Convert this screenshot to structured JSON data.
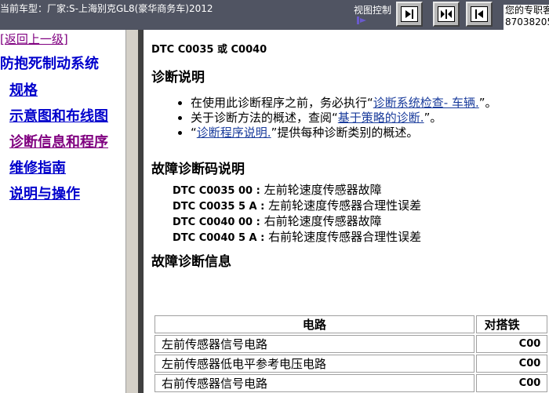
{
  "topbar": {
    "vehicle_label": "当前车型：厂家:S-上海别克GL8(豪华商务车)2012",
    "view_control_label": "视图控制",
    "contact_line1": "您的专职客",
    "contact_line2": "87038205"
  },
  "sidebar": {
    "back_link": "[返回上一级]",
    "system_title": "防抱死制动系统",
    "items": [
      {
        "label": "规格"
      },
      {
        "label": "示意图和布线图"
      },
      {
        "label": "诊断信息和程序"
      },
      {
        "label": "维修指南"
      },
      {
        "label": "说明与操作"
      }
    ]
  },
  "content": {
    "dtc_heading": "DTC C0035 或 C0040",
    "diag_desc_title": "诊断说明",
    "bullets": [
      {
        "pre": "在使用此诊断程序之前，务必执行“",
        "link": "诊断系统检查- 车辆.",
        "post": "”。"
      },
      {
        "pre": "关于诊断方法的概述，查阅“",
        "link": "基于策略的诊断.",
        "post": "”。"
      },
      {
        "pre": "“",
        "link": "诊断程序说明.",
        "post": "”提供每种诊断类别的概述。"
      }
    ],
    "dtc_desc_title": "故障诊断码说明",
    "dtcs": [
      {
        "code": "DTC C0035 00 :",
        "desc": " 左前轮速度传感器故障"
      },
      {
        "code": "DTC C0035 5 A :",
        "desc": " 左前轮速度传感器合理性误差"
      },
      {
        "code": "DTC C0040 00 :",
        "desc": " 右前轮速度传感器故障"
      },
      {
        "code": "DTC C0040 5 A :",
        "desc": " 右前轮速度传感器合理性误差"
      }
    ],
    "dtc_info_title": "故障诊断信息",
    "table": {
      "headers": [
        "电路",
        "对搭铁"
      ],
      "rows": [
        [
          "左前传感器信号电路",
          "C00"
        ],
        [
          "左前传感器低电平参考电压电路",
          "C00"
        ],
        [
          "右前传感器信号电路",
          "C00"
        ]
      ]
    }
  },
  "colors": {
    "topbar_bg": "#505462",
    "link_blue": "#0000cc",
    "visited_purple": "#800080"
  }
}
